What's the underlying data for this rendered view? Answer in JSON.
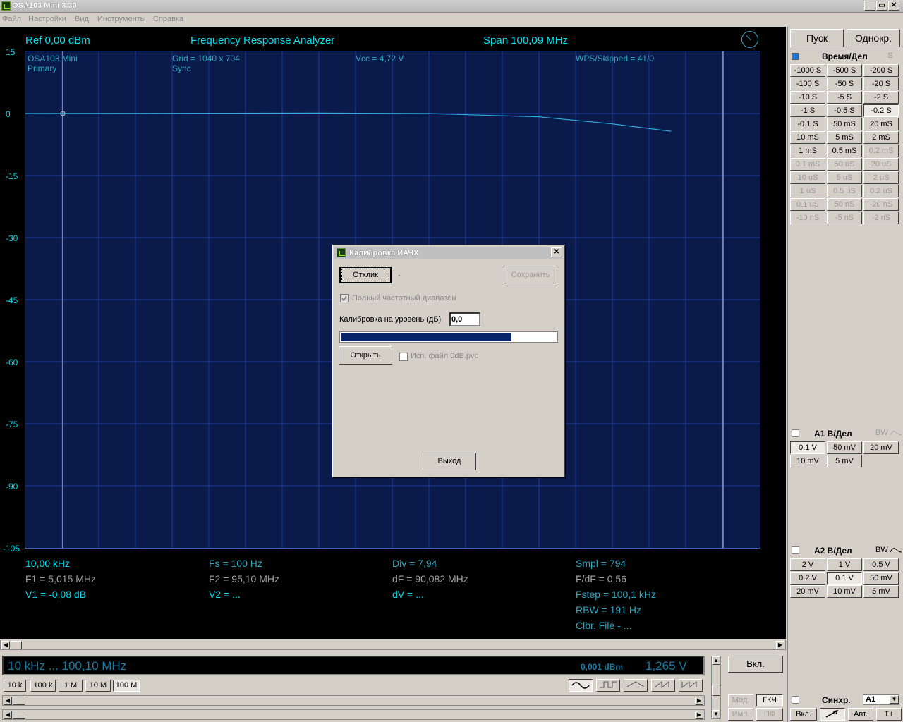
{
  "window": {
    "title": "OSA103 Mini 3.30",
    "btn_min": "_",
    "btn_restore": "▭",
    "btn_close": "✕"
  },
  "menu": [
    "Файл",
    "Настройки",
    "Вид",
    "Инструменты",
    "Справка"
  ],
  "scope": {
    "ref": "Ref  0,00 dBm",
    "title": "Frequency Response Analyzer",
    "span": "Span 100,09 MHz",
    "device": "OSA103 Mini",
    "mode": "Primary",
    "grid": "Grid = 1040 x 704",
    "sync": "Sync",
    "vcc": "Vcc = 4,72 V",
    "wps": "WPS/Skipped  = 41/0",
    "y_ticks": [
      "15",
      "0",
      "-15",
      "-30",
      "-45",
      "-60",
      "-75",
      "-90",
      "-105"
    ]
  },
  "chart_data": {
    "type": "line",
    "series": [
      {
        "values": [
          [
            0.01,
            0
          ],
          [
            40,
            0.1
          ],
          [
            55,
            0
          ],
          [
            70,
            -0.8
          ],
          [
            80,
            -2.5
          ],
          [
            88,
            -4.3
          ]
        ]
      }
    ],
    "ylim": [
      -105,
      15
    ],
    "xlim": [
      0.01,
      100.1
    ],
    "y_ticks": [
      "15",
      "0",
      "-15",
      "-30",
      "-45",
      "-60",
      "-75",
      "-90",
      "-105"
    ]
  },
  "readouts": {
    "c1": [
      "10,00 kHz",
      "F1 = 5,015 MHz",
      "V1 = -0,08 dB"
    ],
    "c2": [
      "Fs = 100 Hz",
      "F2 = 95,10 MHz",
      "V2 = ..."
    ],
    "c3": [
      "Div = 7,94",
      "dF = 90,082 MHz",
      "dV = ..."
    ],
    "c4": [
      "Smpl = 794",
      "F/dF = 0,56",
      "Fstep = 100,1 kHz",
      "RBW = 191 Hz",
      "Clbr. File - ..."
    ]
  },
  "bottom": {
    "range": "10 kHz  ...  100,10 MHz",
    "level": "0,001 dBm",
    "volt": "1,265 V",
    "range_buttons": [
      "10 k",
      "100 k",
      "1 M",
      "10 M",
      "100 M"
    ],
    "on_button": "Вкл.",
    "mod": "Мод.",
    "gen": "ГКЧ",
    "imp": "Имп.",
    "pf": "ПФ"
  },
  "right": {
    "start": "Пуск",
    "single": "Однокр.",
    "time_div": "Время/Дел",
    "time_s": "S",
    "time_buttons": [
      [
        "-1000 S",
        "-500 S",
        "-200 S"
      ],
      [
        "-100 S",
        "-50 S",
        "-20 S"
      ],
      [
        "-10 S",
        "-5 S",
        "-2 S"
      ],
      [
        "-1 S",
        "-0.5 S",
        "-0.2 S"
      ],
      [
        "-0.1 S",
        "50 mS",
        "20 mS"
      ],
      [
        "10 mS",
        "5 mS",
        "2 mS"
      ],
      [
        "1 mS",
        "0.5 mS",
        "0.2 mS"
      ],
      [
        "0.1 mS",
        "50 uS",
        "20 uS"
      ],
      [
        "10 uS",
        "5 uS",
        "2 uS"
      ],
      [
        "1 uS",
        "0.5 uS",
        "0.2 uS"
      ],
      [
        "0.1 uS",
        "50 nS",
        "-20 nS"
      ],
      [
        "-10 nS",
        "-5 nS",
        "-2 nS"
      ]
    ],
    "a1": "A1 В/Дел",
    "a1_bw": "BW",
    "a1_buttons": [
      [
        "0.1 V",
        "50 mV",
        "20 mV"
      ],
      [
        "10 mV",
        "5 mV"
      ]
    ],
    "a2": "A2 В/Дел",
    "a2_bw": "BW",
    "a2_buttons": [
      [
        "2 V",
        "1 V",
        "0.5 V"
      ],
      [
        "0.2 V",
        "0.1 V",
        "50 mV"
      ],
      [
        "20 mV",
        "10 mV",
        "5 mV"
      ]
    ],
    "sync": "Синхр.",
    "sync_src": "A1",
    "sync_on": "Вкл.",
    "auto": "Авт.",
    "tplus": "T+"
  },
  "dialog": {
    "title": "Калибровка ИАЧХ",
    "response_btn": "Отклик",
    "dash": "-",
    "save_btn": "Сохранить",
    "full_range": "Полный частотный диапазон",
    "level_label": "Калибровка на уровень (дБ)",
    "level_value": "0,0",
    "progress": 0.79,
    "open_btn": "Открыть",
    "use_file": "Исп. файл 0dB.pvc",
    "exit_btn": "Выход",
    "close": "✕"
  }
}
